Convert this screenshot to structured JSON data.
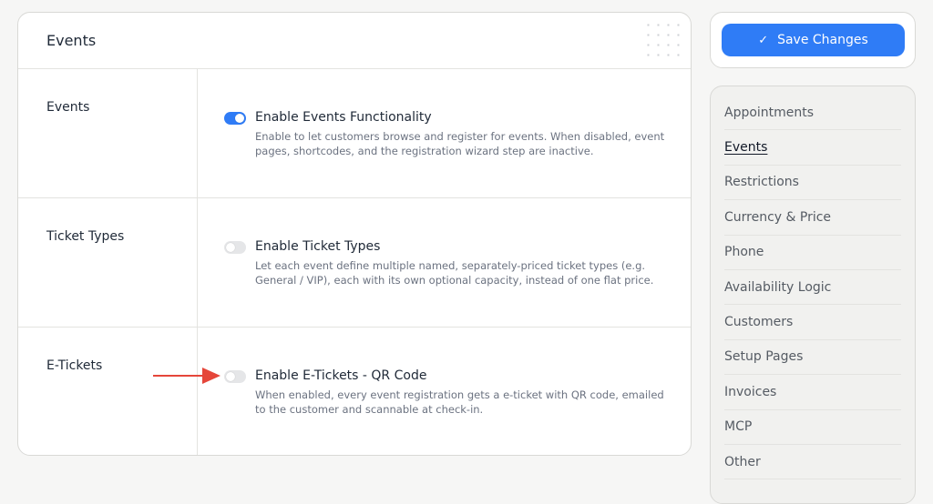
{
  "card": {
    "title": "Events"
  },
  "rows": [
    {
      "label": "Events",
      "toggle_on": true,
      "title": "Enable Events Functionality",
      "description": "Enable to let customers browse and register for events. When disabled, event pages, shortcodes, and the registration wizard step are inactive."
    },
    {
      "label": "Ticket Types",
      "toggle_on": false,
      "title": "Enable Ticket Types",
      "description": "Let each event define multiple named, separately-priced ticket types (e.g. General / VIP), each with its own optional capacity, instead of one flat price."
    },
    {
      "label": "E-Tickets",
      "toggle_on": false,
      "title": "Enable E-Tickets - QR Code",
      "description": "When enabled, every event registration gets a e-ticket with QR code, emailed to the customer and scannable at check-in."
    }
  ],
  "save": {
    "label": "Save Changes",
    "icon": "check-icon"
  },
  "nav": {
    "active": "Events",
    "items": [
      {
        "label": "Appointments"
      },
      {
        "label": "Events"
      },
      {
        "label": "Restrictions"
      },
      {
        "label": "Currency & Price"
      },
      {
        "label": "Phone"
      },
      {
        "label": "Availability Logic"
      },
      {
        "label": "Customers"
      },
      {
        "label": "Setup Pages"
      },
      {
        "label": "Invoices"
      },
      {
        "label": "MCP"
      },
      {
        "label": "Other"
      }
    ]
  },
  "colors": {
    "accent": "#2f7cf6",
    "annotation_arrow": "#e5463a"
  }
}
